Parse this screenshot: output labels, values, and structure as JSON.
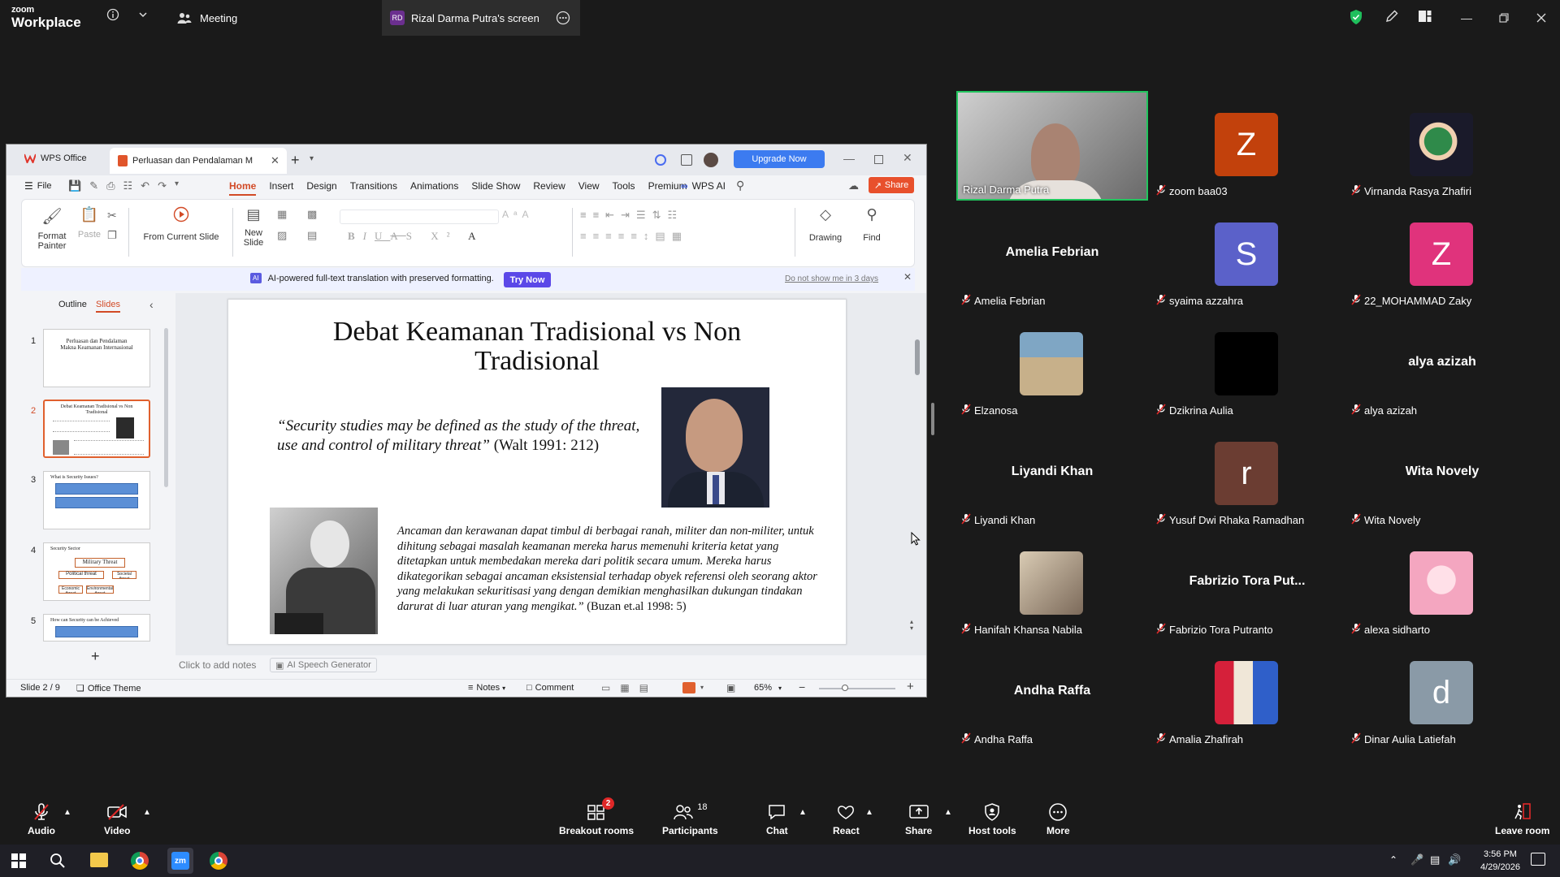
{
  "zoom": {
    "brand_top": "zoom",
    "brand_bottom": "Workplace",
    "meeting_tab": "Meeting",
    "screen_tab": "Rizal Darma Putra's screen",
    "screen_tab_initials": "RD"
  },
  "wps": {
    "app_tab": "WPS Office",
    "doc_tab": "Perluasan dan Pendalaman M",
    "upgrade": "Upgrade Now",
    "menu_file": "File",
    "tabs": [
      "Home",
      "Insert",
      "Design",
      "Transitions",
      "Animations",
      "Slide Show",
      "Review",
      "View",
      "Tools",
      "Premium"
    ],
    "wps_ai": "WPS AI",
    "share": "Share",
    "ribbon": {
      "format_painter": "Format Painter",
      "format_painter_l1": "Format",
      "format_painter_l2": "Painter",
      "paste": "Paste",
      "from_current": "From Current Slide",
      "new_slide_l1": "New",
      "new_slide_l2": "Slide",
      "drawing": "Drawing",
      "find": "Find"
    },
    "banner_text": "AI-powered full-text translation with preserved formatting.",
    "banner_try": "Try Now",
    "banner_dismiss": "Do not show me in 3 days",
    "panel_outline": "Outline",
    "panel_slides": "Slides",
    "thumbs": [
      {
        "num": "1",
        "title": "Perluasan dan Pendalaman Makna Keamanan Internasional"
      },
      {
        "num": "2",
        "title": "Debat Keamanan Tradisional vs Non Tradisional"
      },
      {
        "num": "3",
        "title": "What is Security Issues?"
      },
      {
        "num": "4",
        "title": "Security Sector"
      },
      {
        "num": "5",
        "title": "How can Security can be Achieved"
      }
    ],
    "thumb4_box": "Military Threat",
    "thumb4_sub1": "Political threat",
    "thumb4_sub2": "Societal threat",
    "thumb4_sub3": "Economic threat",
    "thumb4_sub4": "Environmental threat",
    "slide": {
      "title": "Debat Keamanan Tradisional vs Non Tradisional",
      "quote_italic": "“Security studies may be defined as the study of the threat, use and control of military threat”",
      "quote_cite": "(Walt 1991: 212)",
      "body_italic": "Ancaman dan kerawanan dapat timbul di berbagai ranah, militer dan non-militer, untuk dihitung sebagai masalah keamanan mereka harus memenuhi kriteria ketat yang ditetapkan untuk membedakan mereka dari politik secara umum. Mereka harus dikategorikan sebagai ancaman eksistensial terhadap obyek referensi oleh seorang aktor yang melakukan sekuritisasi yang dengan demikian menghasilkan dukungan tindakan darurat di luar aturan yang mengikat.”",
      "body_cite": "(Buzan et.al 1998: 5)"
    },
    "notes_placeholder": "Click to add notes",
    "speech_gen": "AI Speech Generator",
    "status_slide": "Slide 2 / 9",
    "status_theme": "Office Theme",
    "status_notes": "Notes",
    "status_comment": "Comment",
    "zoom_level": "65%"
  },
  "participants": [
    {
      "name": "Rizal Darma Putra",
      "type": "video",
      "muted": false,
      "active": true
    },
    {
      "name": "zoom baa03",
      "letter": "Z",
      "color": "#c2410c",
      "type": "letter",
      "muted": true
    },
    {
      "name": "Virnanda Rasya Zhafiri",
      "type": "image",
      "muted": true
    },
    {
      "name": "Amelia Febrian",
      "type": "name",
      "muted": true
    },
    {
      "name": "syaima azzahra",
      "letter": "S",
      "color": "#5b61c9",
      "type": "letter",
      "muted": true
    },
    {
      "name": "22_MOHAMMAD Zaky",
      "letter": "Z",
      "color": "#e0337c",
      "type": "letter",
      "muted": true
    },
    {
      "name": "Elzanosa",
      "type": "image",
      "muted": true
    },
    {
      "name": "Dzikrina Aulia",
      "type": "black",
      "muted": true
    },
    {
      "name": "alya azizah",
      "type": "name",
      "muted": true
    },
    {
      "name": "Liyandi Khan",
      "type": "name",
      "muted": true
    },
    {
      "name": "Yusuf Dwi Rhaka Ramadhan",
      "letter": "r",
      "color": "#6b3d32",
      "type": "letter",
      "muted": true
    },
    {
      "name": "Wita Novely",
      "type": "name",
      "muted": true
    },
    {
      "name": "Hanifah Khansa Nabila",
      "type": "image",
      "muted": true
    },
    {
      "name": "Fabrizio Tora Putranto",
      "display": "Fabrizio Tora Put...",
      "type": "name",
      "muted": true
    },
    {
      "name": "alexa sidharto",
      "type": "image",
      "muted": true
    },
    {
      "name": "Andha Raffa",
      "type": "name",
      "muted": true
    },
    {
      "name": "Amalia Zhafirah",
      "type": "image",
      "muted": true
    },
    {
      "name": "Dinar Aulia Latiefah",
      "letter": "d",
      "color": "#8a9aa7",
      "type": "letter",
      "muted": true
    }
  ],
  "toolbar": {
    "audio": "Audio",
    "video": "Video",
    "breakout": "Breakout rooms",
    "breakout_badge": "2",
    "participants": "Participants",
    "participants_count": "18",
    "chat": "Chat",
    "react": "React",
    "share": "Share",
    "host_tools": "Host tools",
    "more": "More",
    "leave": "Leave room"
  },
  "taskbar": {
    "time": "3:56 PM",
    "date": "4/29/2026",
    "zm": "zm"
  }
}
